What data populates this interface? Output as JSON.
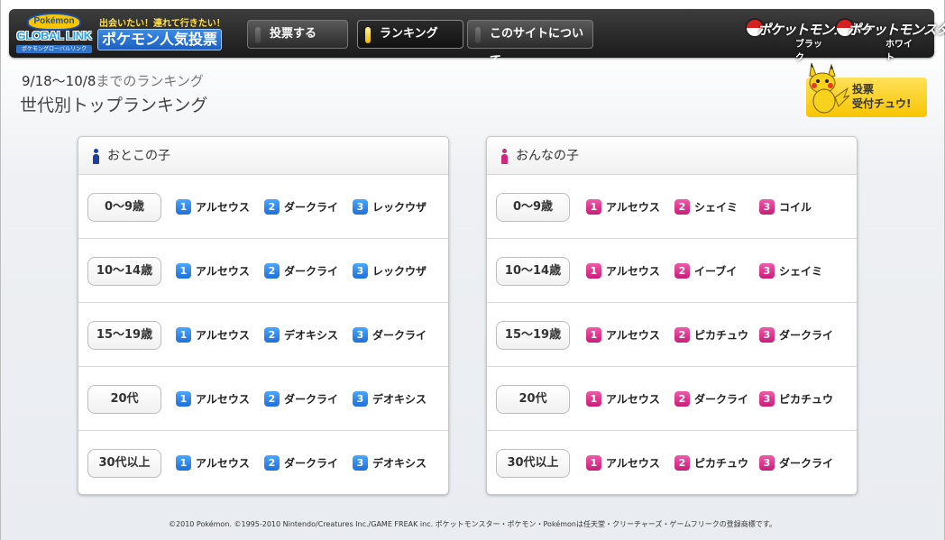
{
  "header": {
    "logo_top": "Pokémon",
    "logo_main": "GLOBAL LINK",
    "logo_sub": "ポケモングローバルリンク",
    "tagline": "出会いたい！連れて行きたい！",
    "site_title": "ポケモン人気投票",
    "nav": [
      {
        "label": "投票する",
        "active": false
      },
      {
        "label": "ランキング",
        "active": true
      },
      {
        "label": "このサイトについて",
        "active": false
      }
    ],
    "game_logos": [
      {
        "name": "ポケットモンスター",
        "version": "ブラック"
      },
      {
        "name": "ポケットモンスター",
        "version": "ホワイト"
      }
    ]
  },
  "page": {
    "period": "9/18〜10/8",
    "period_suffix": "までのランキング",
    "section_title": "世代別トップランキング"
  },
  "vote_badge": {
    "line1": "投票",
    "line2": "受付チュウ!"
  },
  "boys": {
    "title": "おとこの子",
    "color": "#1f3fa0",
    "rows": [
      {
        "age": "0〜9歳",
        "ranks": [
          "アルセウス",
          "ダークライ",
          "レックウザ"
        ]
      },
      {
        "age": "10〜14歳",
        "ranks": [
          "アルセウス",
          "ダークライ",
          "レックウザ"
        ]
      },
      {
        "age": "15〜19歳",
        "ranks": [
          "アルセウス",
          "デオキシス",
          "ダークライ"
        ]
      },
      {
        "age": "20代",
        "ranks": [
          "アルセウス",
          "ダークライ",
          "デオキシス"
        ]
      },
      {
        "age": "30代以上",
        "ranks": [
          "アルセウス",
          "ダークライ",
          "デオキシス"
        ]
      }
    ]
  },
  "girls": {
    "title": "おんなの子",
    "color": "#d0287c",
    "rows": [
      {
        "age": "0〜9歳",
        "ranks": [
          "アルセウス",
          "シェイミ",
          "コイル"
        ]
      },
      {
        "age": "10〜14歳",
        "ranks": [
          "アルセウス",
          "イーブイ",
          "シェイミ"
        ]
      },
      {
        "age": "15〜19歳",
        "ranks": [
          "アルセウス",
          "ピカチュウ",
          "ダークライ"
        ]
      },
      {
        "age": "20代",
        "ranks": [
          "アルセウス",
          "ダークライ",
          "ピカチュウ"
        ]
      },
      {
        "age": "30代以上",
        "ranks": [
          "アルセウス",
          "ピカチュウ",
          "ダークライ"
        ]
      }
    ]
  },
  "rank_numbers": [
    "1",
    "2",
    "3"
  ],
  "footer": "©2010 Pokémon. ©1995-2010 Nintendo/Creatures Inc./GAME FREAK inc. ポケットモンスター・ポケモン・Pokémonは任天堂・クリーチャーズ・ゲームフリークの登録商標です。"
}
